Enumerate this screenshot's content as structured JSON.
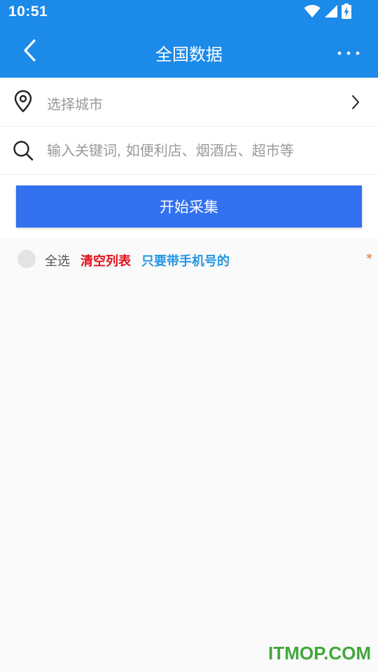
{
  "status_bar": {
    "time": "10:51",
    "icons": [
      "wifi-icon",
      "signal-icon",
      "battery-charging-icon"
    ]
  },
  "app_bar": {
    "title": "全国数据",
    "back_icon": "chevron-left-icon",
    "more_icon": "more-dots-icon"
  },
  "city_row": {
    "label": "选择城市",
    "icon": "location-pin-icon",
    "chevron_icon": "chevron-right-icon"
  },
  "search_row": {
    "placeholder": "输入关键词, 如便利店、烟酒店、超市等",
    "value": "",
    "icon": "search-icon"
  },
  "start_button": {
    "label": "开始采集"
  },
  "options": {
    "select_all_label": "全选",
    "select_all_checked": false,
    "clear_list_label": "清空列表",
    "phone_only_label": "只要带手机号的",
    "asterisk": "*"
  },
  "watermark": {
    "text": "ITMOP.COM"
  },
  "colors": {
    "primary": "#1b8ae8",
    "button": "#3271ef",
    "clear_list": "#e0121b",
    "phone_only": "#2496e3",
    "asterisk": "#f26a1b",
    "watermark": "#42a83a"
  }
}
